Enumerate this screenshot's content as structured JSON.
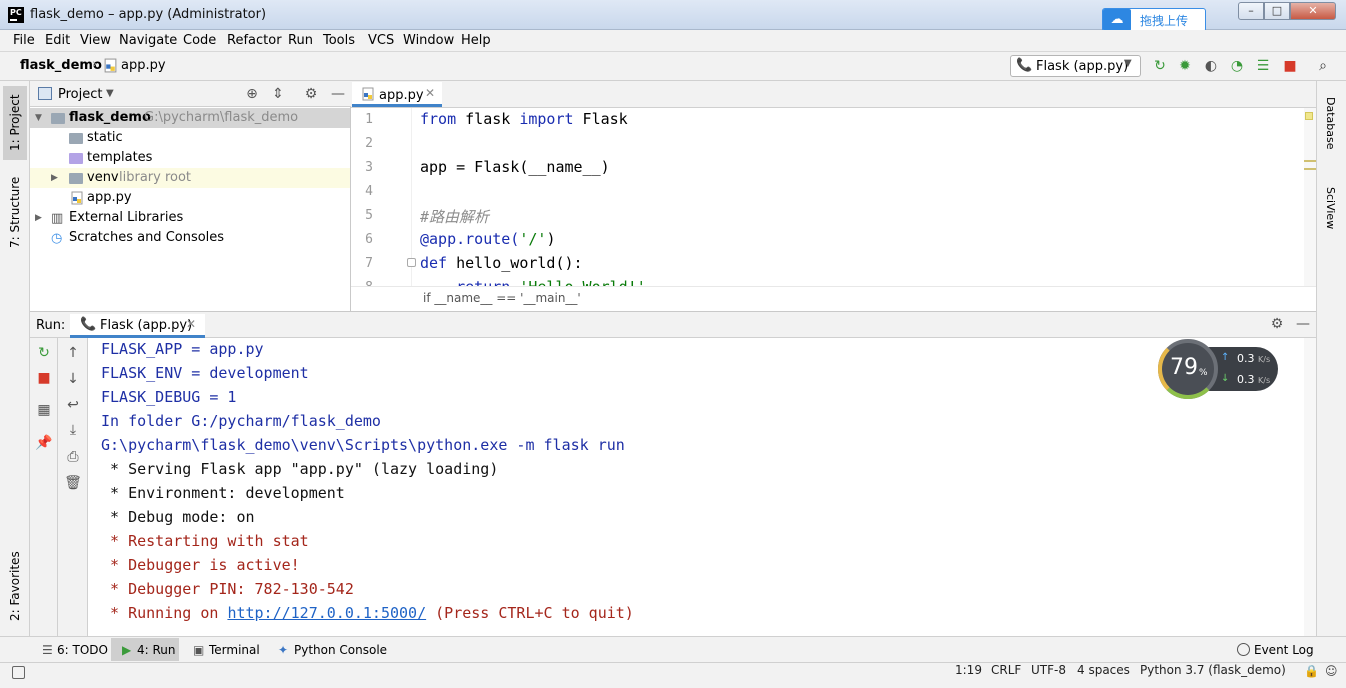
{
  "window": {
    "title": "flask_demo – app.py (Administrator)",
    "logo_text": "PC",
    "upload_button": "拖拽上传",
    "controls": {
      "minimize": "–",
      "maximize": "□",
      "close": "✕"
    }
  },
  "menu": [
    "File",
    "Edit",
    "View",
    "Navigate",
    "Code",
    "Refactor",
    "Run",
    "Tools",
    "VCS",
    "Window",
    "Help"
  ],
  "navbar": {
    "project": "flask_demo",
    "separator": "›",
    "file": "app.py",
    "run_config": "Flask (app.py)"
  },
  "left_tabs": {
    "project": "1: Project",
    "structure": "7: Structure",
    "favorites": "2: Favorites"
  },
  "right_tabs": {
    "database": "Database",
    "sciview": "SciView"
  },
  "project_panel": {
    "title": "Project",
    "tree": {
      "root": {
        "name": "flask_demo",
        "path": "G:\\pycharm\\flask_demo"
      },
      "static": "static",
      "templates": "templates",
      "venv": {
        "name": "venv",
        "hint": "library root"
      },
      "app_py": "app.py",
      "external": "External Libraries",
      "scratches": "Scratches and Consoles"
    }
  },
  "editor": {
    "tab": "app.py",
    "line_numbers": [
      "1",
      "2",
      "3",
      "4",
      "5",
      "6",
      "7",
      "8"
    ],
    "code": {
      "l1_kw1": "from",
      "l1_mid": " flask ",
      "l1_kw2": "import",
      "l1_end": " Flask",
      "l3": "app = Flask(__name__)",
      "l5_comment": "#路由解析",
      "l6_pre": "@app.route(",
      "l6_str": "'/'",
      "l6_post": ")",
      "l7_kw": "def",
      "l7_rest": " hello_world():",
      "l8_kw": "    return",
      "l8_str": " 'Hello World!'"
    },
    "breadcrumb": "if __name__ == '__main__'"
  },
  "run_panel": {
    "label": "Run:",
    "tab": "Flask (app.py)",
    "console": [
      {
        "text": "FLASK_APP = app.py",
        "style": "blue"
      },
      {
        "text": "FLASK_ENV = development",
        "style": "blue"
      },
      {
        "text": "FLASK_DEBUG = 1",
        "style": "blue"
      },
      {
        "text": "In folder G:/pycharm/flask_demo",
        "style": "blue"
      },
      {
        "text": "G:\\pycharm\\flask_demo\\venv\\Scripts\\python.exe -m flask run",
        "style": "blue"
      },
      {
        "text": " * Serving Flask app \"app.py\" (lazy loading)",
        "style": "black"
      },
      {
        "text": " * Environment: development",
        "style": "black"
      },
      {
        "text": " * Debug mode: on",
        "style": "black"
      },
      {
        "text": " * Restarting with stat",
        "style": "red"
      },
      {
        "text": " * Debugger is active!",
        "style": "red"
      },
      {
        "text": " * Debugger PIN: 782-130-542",
        "style": "red"
      }
    ],
    "last_line": {
      "prefix": " * Running on ",
      "link": "http://127.0.0.1:5000/",
      "suffix": " (Press CTRL+C to quit)"
    }
  },
  "net_widget": {
    "percent": "79",
    "percent_sign": "%",
    "up": "0.3",
    "down": "0.3",
    "unit": "K/s"
  },
  "bottom_tabs": {
    "todo": "6: TODO",
    "run": "4: Run",
    "terminal": "Terminal",
    "python_console": "Python Console",
    "event_log": "Event Log"
  },
  "status": {
    "position": "1:19",
    "line_sep": "CRLF",
    "encoding": "UTF-8",
    "indent": "4 spaces",
    "interpreter": "Python 3.7 (flask_demo)"
  },
  "colors": {
    "keyword": "#1a2db0",
    "console_blue": "#1e2fa5",
    "console_red": "#a4261b",
    "link": "#1f63c6",
    "accent_tab": "#4083c9"
  }
}
